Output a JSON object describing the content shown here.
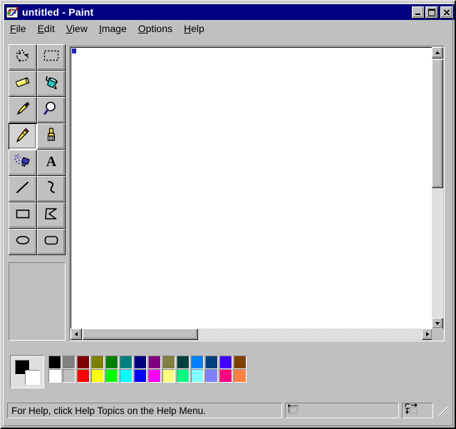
{
  "window": {
    "title": "untitled - Paint",
    "icon": "paint-palette-icon",
    "buttons": [
      {
        "name": "minimize-button",
        "glyph": "minimize-icon",
        "label": "Minimize"
      },
      {
        "name": "maximize-button",
        "glyph": "maximize-icon",
        "label": "Maximize"
      },
      {
        "name": "close-button",
        "glyph": "close-icon",
        "label": "Close"
      }
    ]
  },
  "menubar": {
    "items": [
      {
        "accel": "F",
        "rest": "ile",
        "name": "menu-file"
      },
      {
        "accel": "E",
        "rest": "dit",
        "name": "menu-edit"
      },
      {
        "accel": "V",
        "rest": "iew",
        "name": "menu-view"
      },
      {
        "accel": "I",
        "rest": "mage",
        "name": "menu-image"
      },
      {
        "accel": "O",
        "rest": "ptions",
        "name": "menu-options"
      },
      {
        "accel": "H",
        "rest": "elp",
        "name": "menu-help"
      }
    ]
  },
  "toolbox": {
    "selected": "pencil",
    "tools": [
      {
        "id": "free-form-select",
        "label": "Free-Form Select",
        "icon": "free-form-select-icon"
      },
      {
        "id": "select",
        "label": "Select",
        "icon": "rectangular-select-icon"
      },
      {
        "id": "eraser",
        "label": "Eraser/Color Eraser",
        "icon": "eraser-icon"
      },
      {
        "id": "fill",
        "label": "Fill With Color",
        "icon": "fill-bucket-icon"
      },
      {
        "id": "pick-color",
        "label": "Pick Color",
        "icon": "eyedropper-icon"
      },
      {
        "id": "magnifier",
        "label": "Magnifier",
        "icon": "magnifier-icon"
      },
      {
        "id": "pencil",
        "label": "Pencil",
        "icon": "pencil-icon"
      },
      {
        "id": "brush",
        "label": "Brush",
        "icon": "paintbrush-icon"
      },
      {
        "id": "airbrush",
        "label": "Airbrush",
        "icon": "airbrush-icon"
      },
      {
        "id": "text",
        "label": "Text",
        "icon": "text-tool-icon"
      },
      {
        "id": "line",
        "label": "Line",
        "icon": "line-icon"
      },
      {
        "id": "curve",
        "label": "Curve",
        "icon": "curve-icon"
      },
      {
        "id": "rectangle",
        "label": "Rectangle",
        "icon": "rectangle-icon"
      },
      {
        "id": "polygon",
        "label": "Polygon",
        "icon": "polygon-icon"
      },
      {
        "id": "ellipse",
        "label": "Ellipse",
        "icon": "ellipse-icon"
      },
      {
        "id": "rounded-rectangle",
        "label": "Rounded Rectangle",
        "icon": "rounded-rectangle-icon"
      }
    ]
  },
  "canvas": {
    "background": "#ffffff",
    "vertical_scrollbar": {
      "thumb_top_pct": 0,
      "thumb_height_pct": 50
    },
    "horizontal_scrollbar": {
      "thumb_left_pct": 0,
      "thumb_width_pct": 36
    }
  },
  "palette": {
    "foreground": "#000000",
    "background": "#ffffff",
    "row1": [
      "#000000",
      "#808080",
      "#800000",
      "#808000",
      "#008000",
      "#008080",
      "#000080",
      "#800080",
      "#808040",
      "#004040",
      "#0080ff",
      "#004080",
      "#4000ff",
      "#804000"
    ],
    "row2": [
      "#ffffff",
      "#c0c0c0",
      "#ff0000",
      "#ffff00",
      "#00ff00",
      "#00ffff",
      "#0000ff",
      "#ff00ff",
      "#ffff80",
      "#00ff80",
      "#80ffff",
      "#8080ff",
      "#ff0080",
      "#ff8040"
    ]
  },
  "statusbar": {
    "help_text": "For Help, click Help Topics on the Help Menu.",
    "position_icon": "cursor-position-icon",
    "size_icon": "selection-size-icon",
    "position_value": "",
    "size_value": ""
  }
}
